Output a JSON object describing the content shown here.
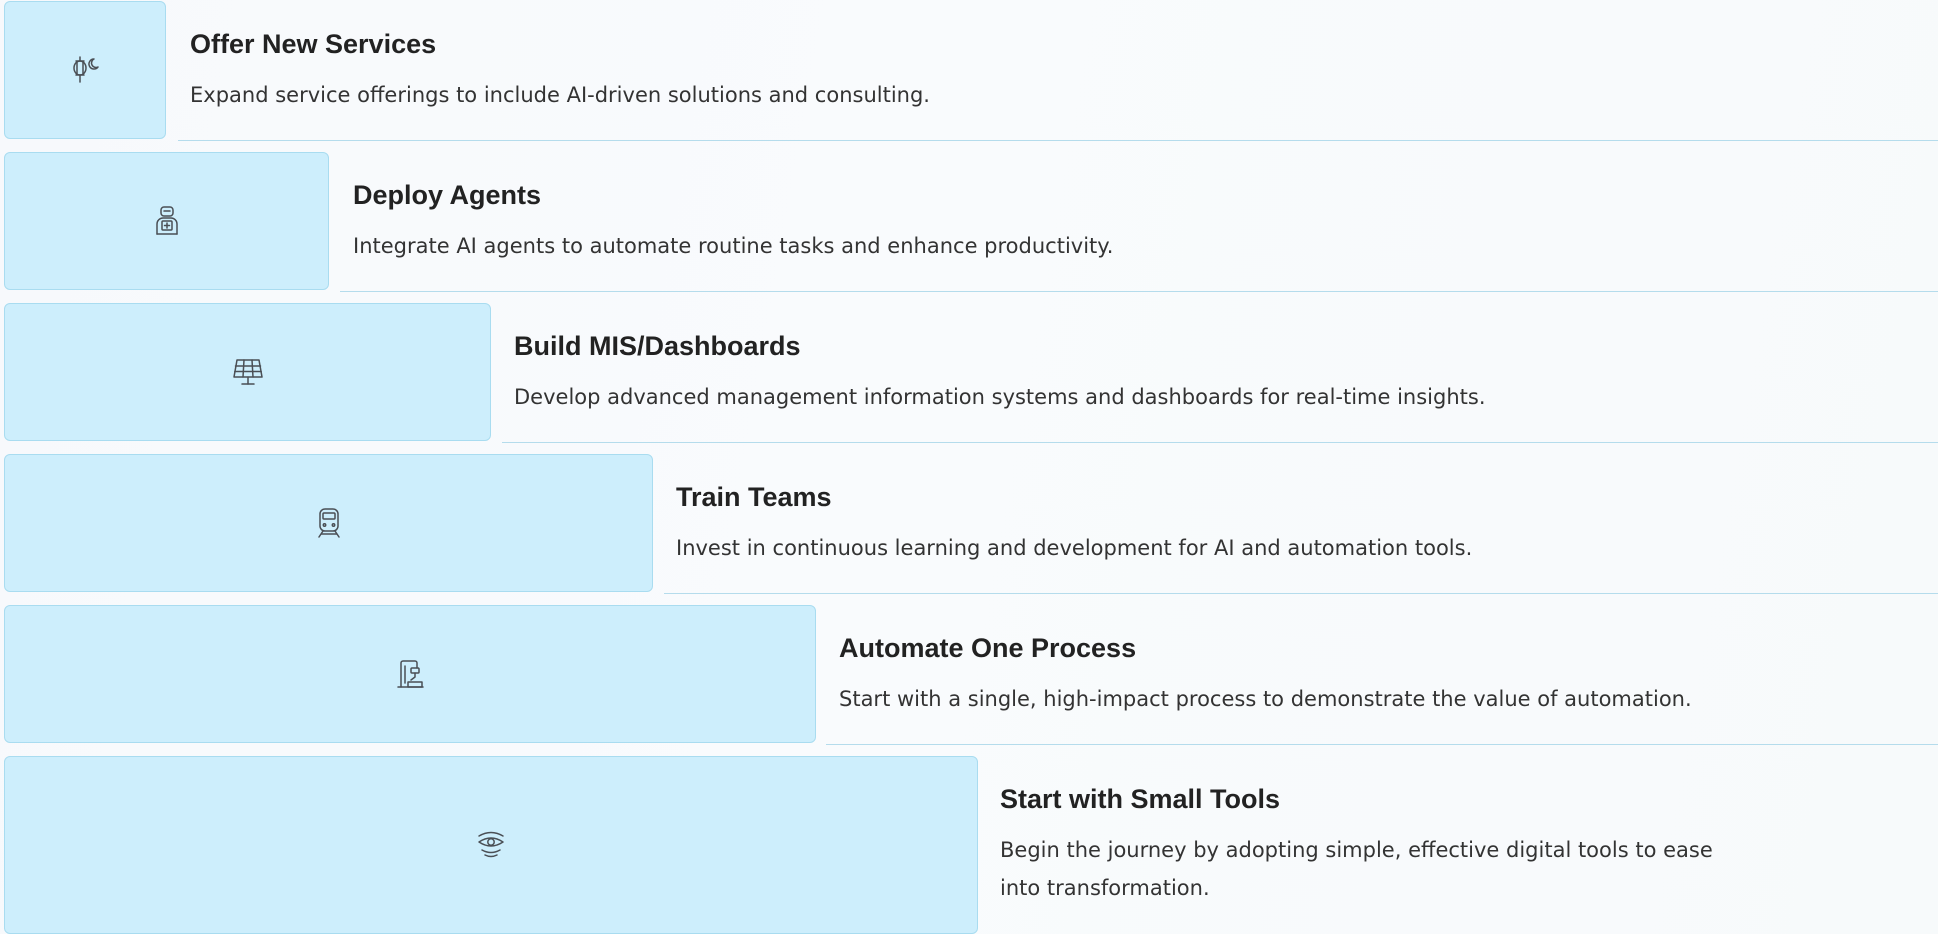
{
  "steps": [
    {
      "title": "Offer New Services",
      "description": "Expand service offerings to include AI-driven solutions and consulting.",
      "icon": "lantern-moon-icon"
    },
    {
      "title": "Deploy Agents",
      "description": "Integrate AI agents to automate routine tasks and enhance productivity.",
      "icon": "robot-icon"
    },
    {
      "title": "Build MIS/Dashboards",
      "description": "Develop advanced management information systems and dashboards for real-time insights.",
      "icon": "solar-panel-icon"
    },
    {
      "title": "Train Teams",
      "description": "Invest in continuous learning and development for AI and automation tools.",
      "icon": "train-icon"
    },
    {
      "title": "Automate One Process",
      "description": "Start with a single, high-impact process to demonstrate the value of automation.",
      "icon": "machine-icon"
    },
    {
      "title": "Start with Small Tools",
      "description": "Begin the journey by adopting simple, effective digital tools to ease into transformation.",
      "icon": "wireless-eye-icon"
    }
  ],
  "colors": {
    "block_fill": "#cdeefc",
    "block_border": "#a9dcf0",
    "rule": "#b5dcec",
    "icon_stroke": "#4a4f55"
  }
}
